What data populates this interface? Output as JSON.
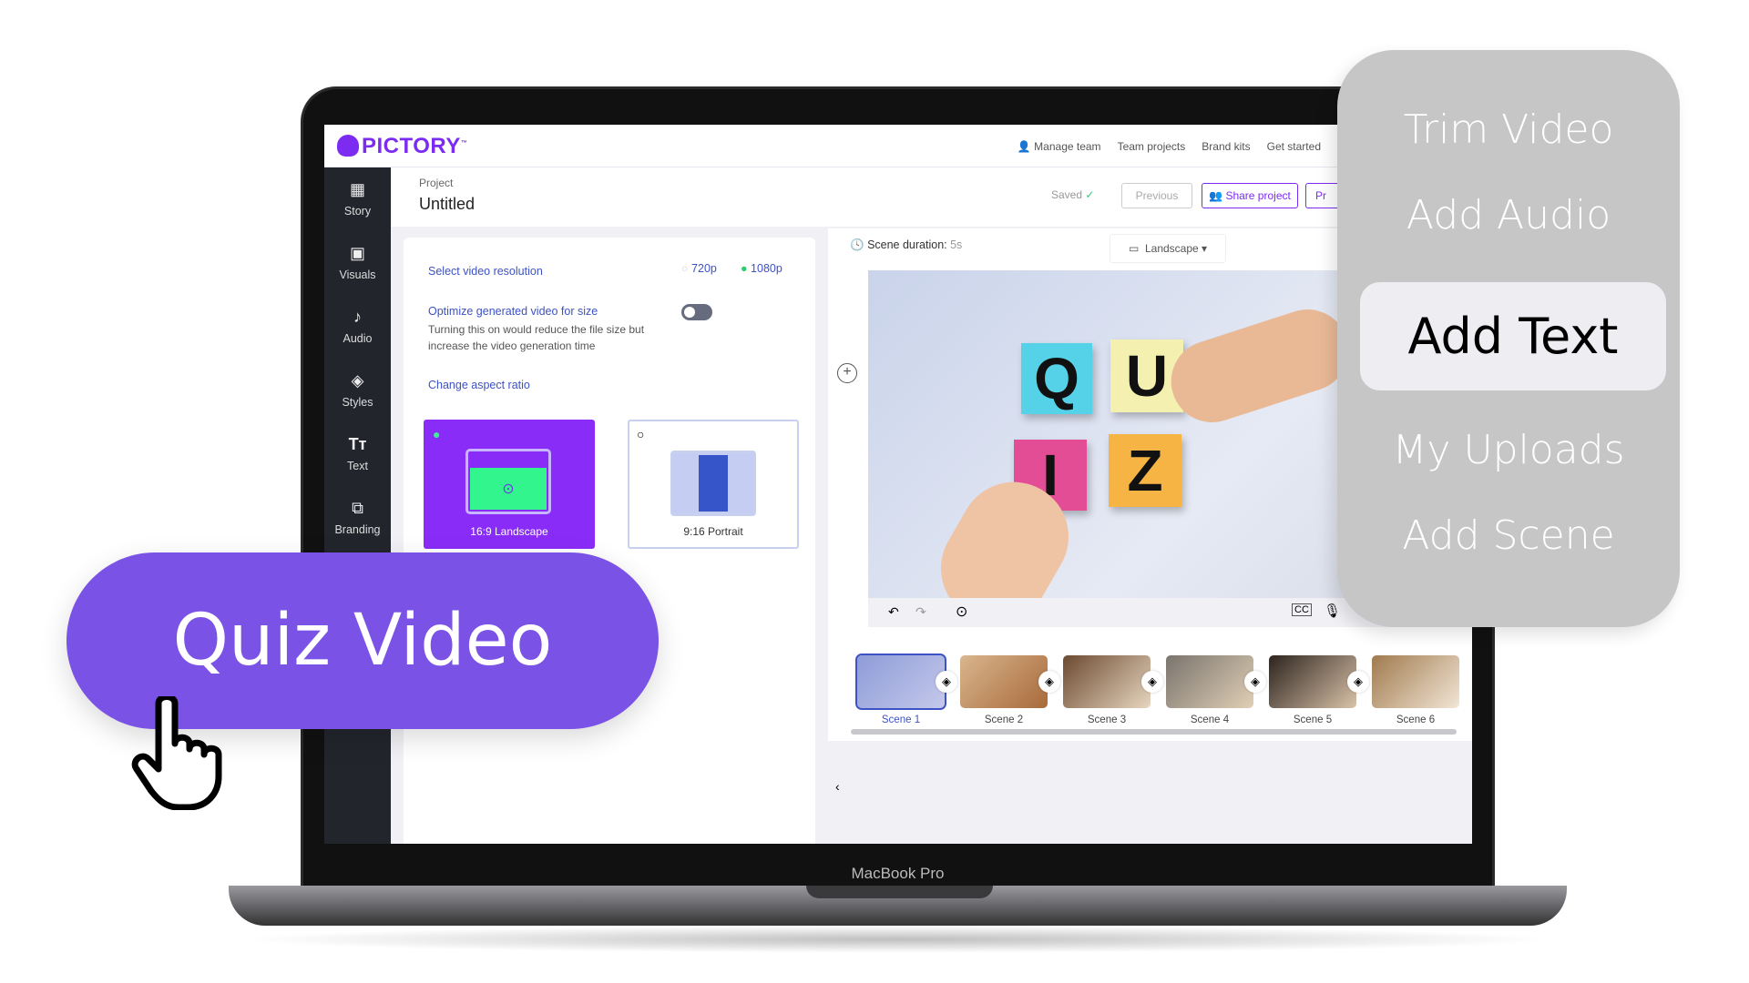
{
  "app": {
    "brand": "PICTORY",
    "trademark": "™"
  },
  "topnav": [
    {
      "label": "Manage team",
      "icon": "user-plus-icon"
    },
    {
      "label": "Team projects"
    },
    {
      "label": "Brand kits"
    },
    {
      "label": "Get started"
    }
  ],
  "project": {
    "breadcrumb": "Project",
    "title": "Untitled",
    "saved": "Saved",
    "previous": "Previous",
    "share": "Share project",
    "next_partial": "Pr"
  },
  "sidebar": [
    {
      "label": "Story",
      "icon": "grid-icon"
    },
    {
      "label": "Visuals",
      "icon": "image-icon"
    },
    {
      "label": "Audio",
      "icon": "music-icon"
    },
    {
      "label": "Styles",
      "icon": "styles-icon"
    },
    {
      "label": "Text",
      "icon": "text-icon"
    },
    {
      "label": "Branding",
      "icon": "briefcase-icon"
    }
  ],
  "settings": {
    "resolution_label": "Select video resolution",
    "resolutions": [
      {
        "label": "720p",
        "selected": false
      },
      {
        "label": "1080p",
        "selected": true
      }
    ],
    "optimize_label": "Optimize generated video for size",
    "optimize_desc_1": "Turning this on would reduce the file size but",
    "optimize_desc_2": "increase the video generation time",
    "optimize_on": false,
    "aspect_label": "Change aspect ratio",
    "aspects": [
      {
        "label": "16:9 Landscape",
        "selected": true
      },
      {
        "label": "9:16 Portrait",
        "selected": false
      }
    ]
  },
  "preview": {
    "duration_label": "Scene duration:",
    "duration_value": "5s",
    "layout": "Landscape",
    "letters": [
      "Q",
      "U",
      "I",
      "Z"
    ]
  },
  "scenes": [
    {
      "label": "Scene 1",
      "active": true
    },
    {
      "label": "Scene 2"
    },
    {
      "label": "Scene 3"
    },
    {
      "label": "Scene 4"
    },
    {
      "label": "Scene 5"
    },
    {
      "label": "Scene 6"
    }
  ],
  "device_label": "MacBook Pro",
  "menu": [
    "Trim Video",
    "Add Audio",
    "Add Text",
    "My Uploads",
    "Add Scene"
  ],
  "menu_selected": "Add Text",
  "cta": "Quiz Video",
  "colors": {
    "brand": "#7c2cf0",
    "accent_blue": "#3d52c4",
    "pill": "#7b52e6",
    "success": "#2ecc71"
  }
}
